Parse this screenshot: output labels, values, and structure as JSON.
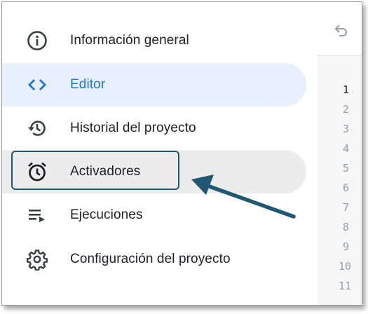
{
  "sidebar": {
    "items": [
      {
        "label": "Información general",
        "icon": "info-icon",
        "state": "default"
      },
      {
        "label": "Editor",
        "icon": "code-icon",
        "state": "active"
      },
      {
        "label": "Historial del proyecto",
        "icon": "history-icon",
        "state": "default"
      },
      {
        "label": "Activadores",
        "icon": "alarm-icon",
        "state": "hover"
      },
      {
        "label": "Ejecuciones",
        "icon": "executions-icon",
        "state": "default"
      },
      {
        "label": "Configuración del proyecto",
        "icon": "gear-icon",
        "state": "default"
      }
    ]
  },
  "editor": {
    "line_numbers": [
      "1",
      "2",
      "3",
      "4",
      "5",
      "6",
      "7",
      "8",
      "9",
      "10",
      "11"
    ],
    "toolbar_icon": "undo-icon"
  },
  "annotation": {
    "highlight_color": "#1f5873",
    "highlight_target": "Activadores",
    "arrow_icon": "arrow-icon"
  },
  "colors": {
    "active_bg": "#e8f0fe",
    "active_text": "#1a73e8",
    "hover_bg": "#ececec",
    "text": "#202124"
  }
}
